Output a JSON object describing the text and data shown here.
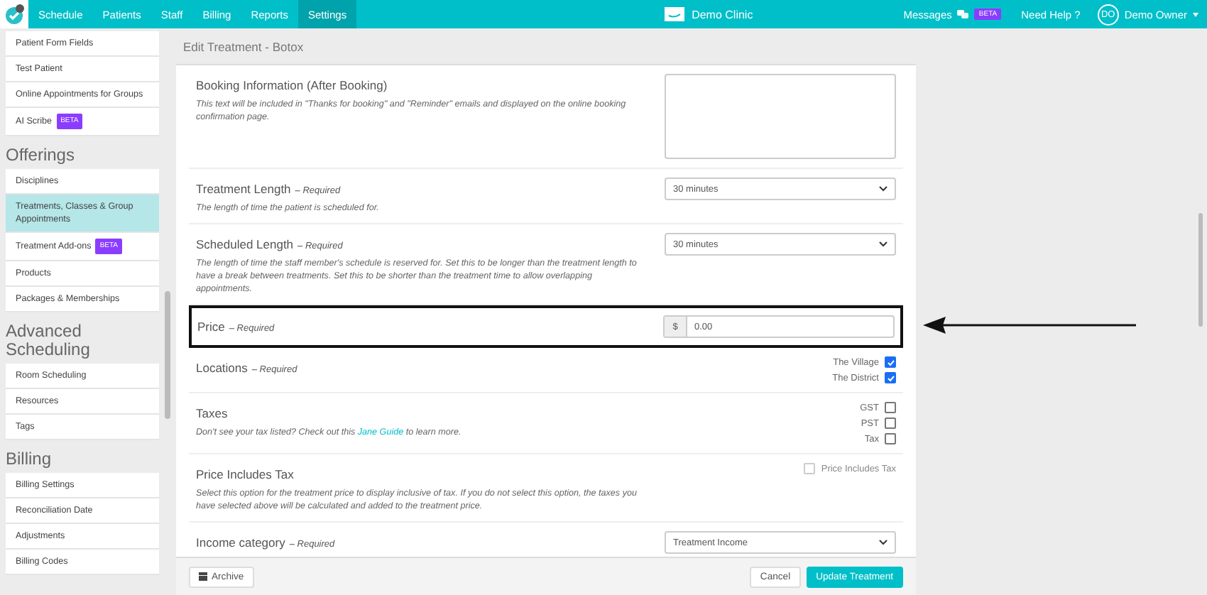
{
  "nav": {
    "items": [
      {
        "label": "Schedule",
        "selected": false
      },
      {
        "label": "Patients",
        "selected": false
      },
      {
        "label": "Staff",
        "selected": false
      },
      {
        "label": "Billing",
        "selected": false
      },
      {
        "label": "Reports",
        "selected": false
      },
      {
        "label": "Settings",
        "selected": true
      }
    ],
    "clinic": "Demo Clinic",
    "messages": "Messages",
    "messages_badge": "BETA",
    "help": "Need Help ?",
    "avatar": "DO",
    "user": "Demo Owner"
  },
  "sidebar": [
    {
      "items": [
        {
          "label": "Patient Form Fields",
          "selected": false
        },
        {
          "label": "Test Patient",
          "selected": false
        },
        {
          "label": "Online Appointments for Groups",
          "selected": false
        },
        {
          "label": "AI Scribe",
          "badge": "BETA",
          "selected": false
        }
      ]
    },
    {
      "heading": "Offerings",
      "items": [
        {
          "label": "Disciplines",
          "selected": false
        },
        {
          "label": "Treatments, Classes & Group Appointments",
          "selected": true
        },
        {
          "label": "Treatment Add-ons",
          "badge": "BETA",
          "selected": false
        },
        {
          "label": "Products",
          "selected": false
        },
        {
          "label": "Packages & Memberships",
          "selected": false
        }
      ]
    },
    {
      "heading": "Advanced Scheduling",
      "items": [
        {
          "label": "Room Scheduling",
          "selected": false
        },
        {
          "label": "Resources",
          "selected": false
        },
        {
          "label": "Tags",
          "selected": false
        }
      ]
    },
    {
      "heading": "Billing",
      "items": [
        {
          "label": "Billing Settings",
          "selected": false
        },
        {
          "label": "Reconciliation Date",
          "selected": false
        },
        {
          "label": "Adjustments",
          "selected": false
        },
        {
          "label": "Billing Codes",
          "selected": false
        }
      ]
    }
  ],
  "panel": {
    "title": "Edit Treatment - Botox",
    "sections": [
      {
        "kind": "textarea",
        "label": "Booking Information (After Booking)",
        "description": "This text will be included in \"Thanks for booking\" and \"Reminder\" emails and displayed on the online booking confirmation page.",
        "highlighted": false
      },
      {
        "kind": "select",
        "label": "Treatment Length",
        "required": "– Required",
        "description": "The length of time the patient is scheduled for.",
        "value": "30 minutes",
        "highlighted": false
      },
      {
        "kind": "select",
        "label": "Scheduled Length",
        "required": "– Required",
        "description": "The length of time the staff member's schedule is reserved for. Set this to be longer than the treatment length to have a break between treatments. Set this to be shorter than the treatment time to allow overlapping appointments.",
        "value": "30 minutes",
        "highlighted": false
      },
      {
        "kind": "price",
        "label": "Price",
        "required": "– Required",
        "prefix": "$",
        "value": "0.00",
        "highlighted": true
      },
      {
        "kind": "checkboxes",
        "label": "Locations",
        "required": "– Required",
        "options": [
          {
            "label": "The Village",
            "checked": true,
            "disabled": false
          },
          {
            "label": "The District",
            "checked": true,
            "disabled": false
          }
        ],
        "highlighted": false
      },
      {
        "kind": "checkboxes",
        "label": "Taxes",
        "description": "Don't see your tax listed? Check out this",
        "link": "Jane Guide",
        "description_after": "to learn more.",
        "options": [
          {
            "label": "GST",
            "checked": false,
            "disabled": false
          },
          {
            "label": "PST",
            "checked": false,
            "disabled": false
          },
          {
            "label": "Tax",
            "checked": false,
            "disabled": false
          }
        ],
        "highlighted": false
      },
      {
        "kind": "checkbox_left",
        "label": "Price Includes Tax",
        "description": "Select this option for the treatment price to display inclusive of tax. If you do not select this option, the taxes you have selected above will be calculated and added to the treatment price.",
        "options": [
          {
            "label": "Price Includes Tax",
            "checked": false,
            "disabled": true
          }
        ],
        "highlighted": false
      },
      {
        "kind": "select",
        "label": "Income category",
        "required": "– Required",
        "value": "Treatment Income",
        "highlighted": false
      }
    ],
    "archive": "Archive",
    "cancel": "Cancel",
    "submit": "Update Treatment"
  }
}
